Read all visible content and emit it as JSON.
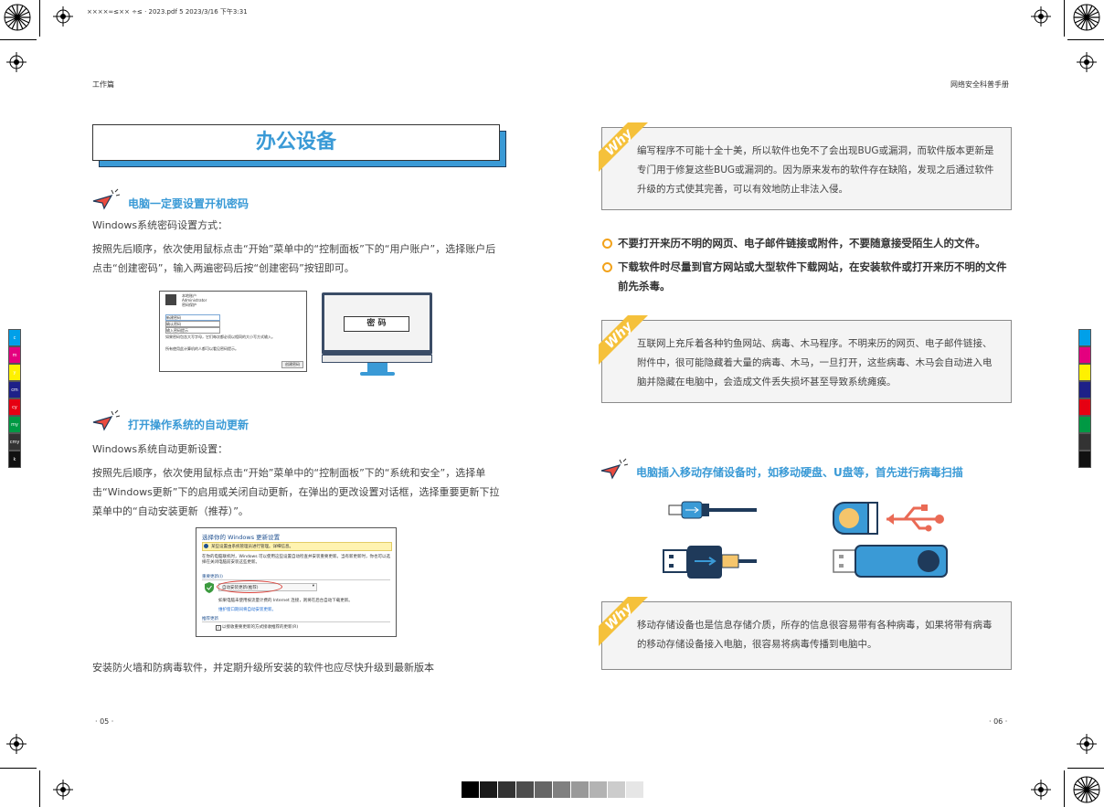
{
  "file_info": "××××∞≤×× ÷≤ · 2023.pdf   5   2023/3/16   下午3:31",
  "left_page": {
    "running_head": "工作篇",
    "title": "办公设备",
    "section1": {
      "heading": "电脑一定要设置开机密码",
      "intro": "Windows系统密码设置方式：",
      "body": "按照先后顺序，依次使用鼠标点击“开始”菜单中的“控制面板”下的“用户账户”，选择账户后点击“创建密码”，输入两遍密码后按“创建密码”按钮即可。",
      "dialog": {
        "user_lines": [
          "本地账户",
          "Administrator",
          "密码保护"
        ],
        "fields": [
          "新建密码",
          "确认密码",
          "输入密码提示"
        ],
        "note1": "如果密码包含大写字母，它们每次都必须以相同的大小写方式输入。",
        "note2": "所有使用此计算机的人都可以看见密码提示。",
        "button": "创建密码"
      },
      "monitor_label": "密 码"
    },
    "section2": {
      "heading": "打开操作系统的自动更新",
      "intro": "Windows系统自动更新设置：",
      "body": "按照先后顺序，依次使用鼠标点击“开始”菜单中的“控制面板”下的“系统和安全”，选择单击“Windows更新”下的启用或关闭自动更新，在弹出的更改设置对话框，选择重要更新下拉菜单中的“自动安装更新（推荐）”。",
      "dialog": {
        "title": "选择你的 Windows 更新设置",
        "banner": "某些设置由系统管理员进行管理。详细信息。",
        "desc": "在你的电脑联机时，Windows 可以使用这些设置自动检查并安装重要更新。当有新更新时，你也可以选择在关闭电脑前安装这些更新。",
        "group1": "重要更新(I)",
        "select": "自动安装更新(推荐)",
        "line1": "如果电脑未使用按流量计费的 Internet 连接，则将在后台自动下载更新。",
        "link": "维护窗口期间将自动安装更新。",
        "group2": "推荐更新",
        "check": "以接收重要更新的方式接收推荐的更新(R)"
      }
    },
    "footer_text": "安装防火墙和防病毒软件，并定期升级所安装的软件也应尽快升级到最新版本",
    "page_number": "· 05 ·"
  },
  "right_page": {
    "running_head": "网络安全科普手册",
    "why_label": "Why",
    "why1": "编写程序不可能十全十美，所以软件也免不了会出现BUG或漏洞，而软件版本更新是专门用于修复这些BUG或漏洞的。因为原来发布的软件存在缺陷，发现之后通过软件升级的方式使其完善，可以有效地防止非法入侵。",
    "bullets": [
      "不要打开来历不明的网页、电子邮件链接或附件，不要随意接受陌生人的文件。",
      "下载软件时尽量到官方网站或大型软件下载网站，在安装软件或打开来历不明的文件前先杀毒。"
    ],
    "why2": "互联网上充斥着各种钓鱼网站、病毒、木马程序。不明来历的网页、电子邮件链接、附件中，很可能隐藏着大量的病毒、木马，一旦打开，这些病毒、木马会自动进入电脑并隐藏在电脑中，会造成文件丢失损坏甚至导致系统瘫痪。",
    "section3_heading": "电脑插入移动存储设备时，如移动硬盘、U盘等，首先进行病毒扫描",
    "why3": "移动存储设备也是信息存储介质，所存的信息很容易带有各种病毒，如果将带有病毒的移动存储设备接入电脑，很容易将病毒传播到电脑中。",
    "page_number": "· 06 ·"
  },
  "colors": {
    "accent_blue": "#3a9ad6",
    "why_yellow": "#f5c13b",
    "bullet_orange": "#f2a21b",
    "dark_navy": "#1f3a5a",
    "usb_red": "#ea6a55"
  },
  "color_bars_left": [
    "#00a0e9",
    "#e4007f",
    "#fff100",
    "#1d2088",
    "#e60012",
    "#009944",
    "#333333",
    "#111111"
  ],
  "color_bars_left_labels": [
    "c",
    "m",
    "y",
    "cm",
    "cy",
    "my",
    "cmy",
    "k"
  ],
  "color_bars_right": [
    "#00a0e9",
    "#e4007f",
    "#fff100",
    "#1d2088",
    "#e60012",
    "#009944",
    "#333333",
    "#111111"
  ],
  "gray_scale": [
    "#000000",
    "#1a1a1a",
    "#333333",
    "#4d4d4d",
    "#666666",
    "#808080",
    "#999999",
    "#b3b3b3",
    "#cccccc",
    "#e6e6e6"
  ]
}
